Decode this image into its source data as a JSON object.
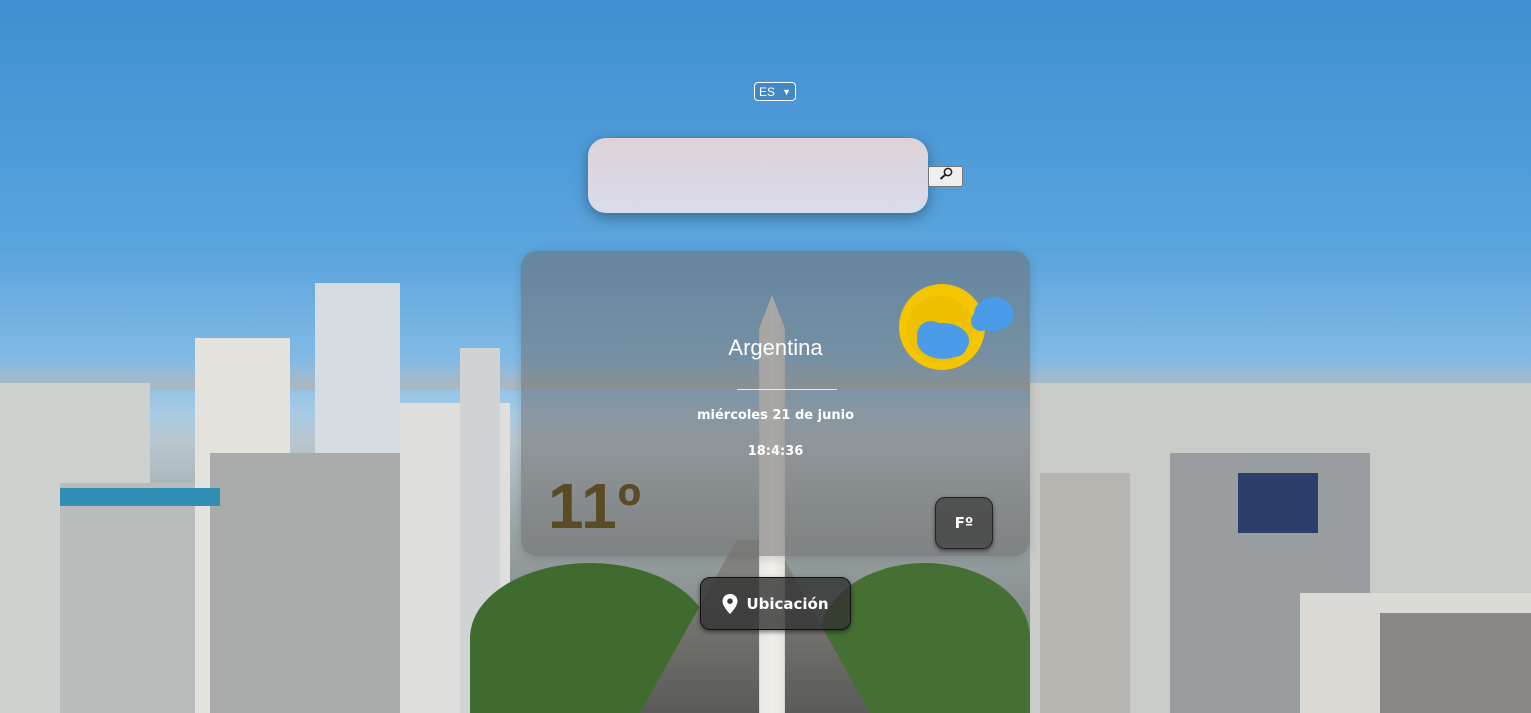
{
  "language": {
    "selected": "ES"
  },
  "search": {
    "placeholder": "",
    "value": "",
    "button_icon": "magnifier-icon"
  },
  "weather": {
    "city": "Argentina",
    "date": "miércoles 21 de junio",
    "time": "18:4:36",
    "temperature": "11º",
    "unit_toggle": "Fº",
    "icon": "partly-cloudy-icon"
  },
  "location_button": {
    "label": "Ubicación",
    "icon": "map-pin-icon"
  },
  "colors": {
    "temperature": "#5a4a25",
    "sun": "#f5c500",
    "cloud": "#4a9be8"
  }
}
